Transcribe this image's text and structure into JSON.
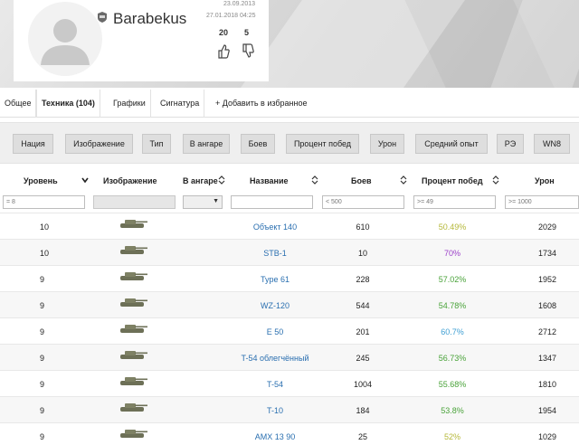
{
  "profile": {
    "name": "Barabekus",
    "date_registered": "23.09.2013",
    "date_last": "27.01.2018 04:25",
    "likes": "20",
    "dislikes": "5",
    "icons": {
      "avatar": "default-avatar-icon",
      "game": "wot-logo-icon",
      "like": "thumbs-up-icon",
      "dislike": "thumbs-down-icon"
    }
  },
  "tabs": [
    {
      "label": "Общее"
    },
    {
      "label": "Техника (104)",
      "active": true
    },
    {
      "label": "Графики"
    },
    {
      "label": "Сигнатура"
    },
    {
      "label": "+ Добавить в избранное"
    }
  ],
  "toolbar": {
    "buttons": [
      "Нация",
      "Изображение",
      "Тип",
      "В ангаре",
      "Боев",
      "Процент побед",
      "Урон",
      "Средний опыт",
      "РЭ",
      "WN8"
    ]
  },
  "table": {
    "headers": {
      "level": "Уровень",
      "image": "Изображение",
      "garage": "В ангаре",
      "name": "Название",
      "battles": "Боев",
      "winrate": "Процент побед",
      "damage": "Урон"
    },
    "filters": {
      "level": "= 8",
      "battles": "< 500",
      "winrate": ">= 49",
      "damage": ">= 1000"
    },
    "rows": [
      {
        "level": "10",
        "name": "Объект 140",
        "battles": "610",
        "winrate": "50.49%",
        "wr_color": "#b5b83a",
        "damage": "2029"
      },
      {
        "level": "10",
        "name": "STB-1",
        "battles": "10",
        "winrate": "70%",
        "wr_color": "#9b3fc9",
        "damage": "1734"
      },
      {
        "level": "9",
        "name": "Type 61",
        "battles": "228",
        "winrate": "57.02%",
        "wr_color": "#4aa33a",
        "damage": "1952"
      },
      {
        "level": "9",
        "name": "WZ-120",
        "battles": "544",
        "winrate": "54.78%",
        "wr_color": "#4aa33a",
        "damage": "1608"
      },
      {
        "level": "9",
        "name": "E 50",
        "battles": "201",
        "winrate": "60.7%",
        "wr_color": "#3f9fd3",
        "damage": "2712"
      },
      {
        "level": "9",
        "name": "T-54 облегчённый",
        "battles": "245",
        "winrate": "56.73%",
        "wr_color": "#4aa33a",
        "damage": "1347"
      },
      {
        "level": "9",
        "name": "T-54",
        "battles": "1004",
        "winrate": "55.68%",
        "wr_color": "#4aa33a",
        "damage": "1810"
      },
      {
        "level": "9",
        "name": "T-10",
        "battles": "184",
        "winrate": "53.8%",
        "wr_color": "#4aa33a",
        "damage": "1954"
      },
      {
        "level": "9",
        "name": "AMX 13 90",
        "battles": "25",
        "winrate": "52%",
        "wr_color": "#b5b83a",
        "damage": "1029"
      }
    ]
  }
}
